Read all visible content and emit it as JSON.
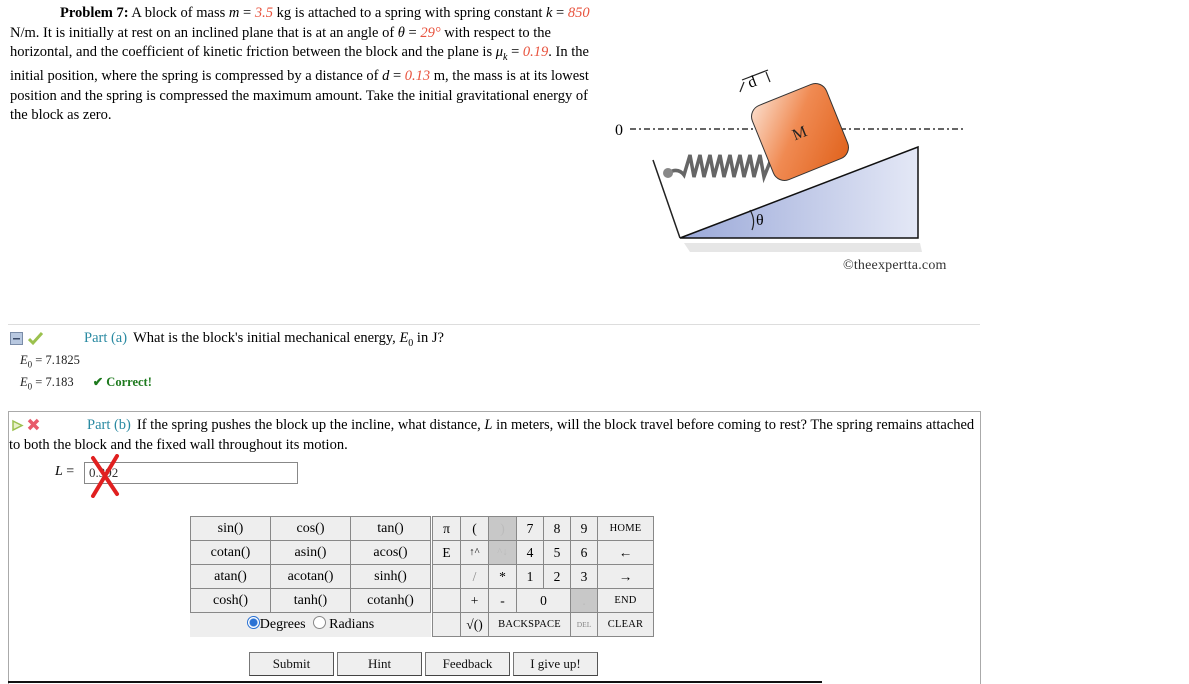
{
  "problem": {
    "label": "Problem 7:",
    "segments": [
      {
        "t": " A block of mass "
      },
      {
        "v": "m",
        "var": true
      },
      {
        "t": " = "
      },
      {
        "v": "3.5",
        "val": true
      },
      {
        "t": " kg is attached to a spring with spring constant "
      },
      {
        "v": "k",
        "var": true
      },
      {
        "t": " = "
      },
      {
        "v": "850",
        "val": true
      },
      {
        "t": " N/m. It is initially at rest on an inclined plane that is at an angle of "
      },
      {
        "v": "θ",
        "var": true
      },
      {
        "t": " = "
      },
      {
        "v": "29°",
        "val": true
      },
      {
        "t": " with respect to the horizontal, and the coefficient of kinetic friction between the block and the plane is "
      },
      {
        "v": "μ",
        "var": true,
        "sub": "k"
      },
      {
        "t": " = "
      },
      {
        "v": "0.19",
        "val": true
      },
      {
        "t": ". In the initial position, where the spring is compressed by a distance of "
      },
      {
        "v": "d",
        "var": true
      },
      {
        "t": " = "
      },
      {
        "v": "0.13",
        "val": true
      },
      {
        "t": " m, the mass is at its lowest position and the spring is compressed the maximum amount. Take the initial gravitational energy of the block as zero."
      }
    ]
  },
  "figure": {
    "zero_label": "0",
    "block_label": "M",
    "d_label": "d",
    "angle_label": "θ",
    "copyright": "©theexpertta.com",
    "colors": {
      "block": "#e8702e",
      "incline": "#b9c3e4",
      "spring": "#6b6b6b"
    }
  },
  "part_a": {
    "label": "Part (a)",
    "question_pre": "What is the block's initial mechanical energy, ",
    "var": "E",
    "sub": "0",
    "question_post": " in J?",
    "answers": [
      {
        "var": "E",
        "sub": "0",
        "text": " = 7.1825"
      },
      {
        "var": "E",
        "sub": "0",
        "text": " = 7.183"
      }
    ],
    "status": "✔ Correct!"
  },
  "part_b": {
    "label": "Part (b)",
    "question_pre": "If the spring pushes the block up the incline, what distance, ",
    "var": "L",
    "question_post": " in meters, will the block travel before coming to rest? The spring remains attached to both the block and the fixed wall throughout its motion.",
    "input_label": "L",
    "input_eq": " = ",
    "input_value": "0.392",
    "status": "incorrect"
  },
  "calculator": {
    "functions": [
      [
        "sin()",
        "cos()",
        "tan()"
      ],
      [
        "cotan()",
        "asin()",
        "acos()"
      ],
      [
        "atan()",
        "acotan()",
        "sinh()"
      ],
      [
        "cosh()",
        "tanh()",
        "cotanh()"
      ]
    ],
    "angle_mode": {
      "options": [
        "Degrees",
        "Radians"
      ],
      "selected": "Degrees"
    },
    "keys": {
      "pi": "π",
      "lparen": "(",
      "rparen": ")",
      "seven": "7",
      "eight": "8",
      "nine": "9",
      "home": "HOME",
      "e": "E",
      "up": "↑^",
      "down": "^↓",
      "four": "4",
      "five": "5",
      "six": "6",
      "left": "←",
      "div": "/",
      "mul": "*",
      "one": "1",
      "two": "2",
      "three": "3",
      "right": "→",
      "plus": "+",
      "minus": "-",
      "zero": "0",
      "dot": ".",
      "end": "END",
      "sqrt": "√()",
      "backspace": "BACKSPACE",
      "del": "DEL",
      "clear": "CLEAR"
    }
  },
  "buttons": {
    "submit": "Submit",
    "hint": "Hint",
    "feedback": "Feedback",
    "give_up": "I give up!"
  }
}
